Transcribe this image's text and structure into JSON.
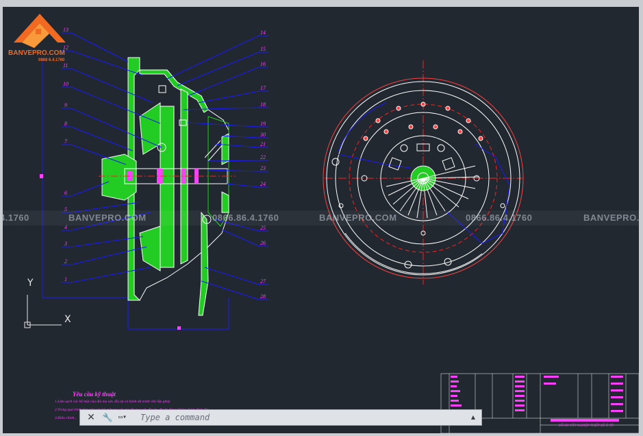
{
  "watermark": {
    "brand": "BANVEPRO.COM",
    "phone": "0866.86.4.1760",
    "phone_fragment": "4.1760",
    "brand_fragment": "BANVEPRO.C"
  },
  "logo": {
    "brand": "BANVEPRO.COM",
    "phone": "0868 6.4.1760"
  },
  "callouts_left": [
    "13",
    "12",
    "11",
    "10",
    "9",
    "8",
    "7",
    "6",
    "5",
    "4",
    "3",
    "2",
    "1"
  ],
  "callouts_right": [
    "14",
    "15",
    "16",
    "17",
    "18",
    "19",
    "30",
    "21",
    "22",
    "23",
    "24",
    "25",
    "26",
    "27",
    "28"
  ],
  "ucs": {
    "x_label": "X",
    "y_label": "Y"
  },
  "notes": {
    "title": "Yêu cầu kỹ thuật",
    "items": [
      "1.Làm sạch các bề mặt của đĩa ma sát, đĩa ép và bánh đà trước khi lắp ghép",
      "2.Trong quá trình làm việc các bề mặt ma sát của đĩa ma sát, đĩa ép, đĩa bị động không được dính dầu",
      "3.Điều chỉnh..."
    ]
  },
  "command_line": {
    "placeholder": "Type a command",
    "close_icon": "close-icon",
    "settings_icon": "wrench-icon",
    "prompt_icon": "command-prompt-icon",
    "history_icon": "chevron-up-icon"
  },
  "title_block": {
    "caption": "ĐỒ ÁN TỐT NGHIỆP  THIẾT KẾ Ô TÔ"
  },
  "colors": {
    "background": "#212830",
    "outline": "#ffffff",
    "section_fill": "#22cc22",
    "leader": "#1a1aff",
    "text": "#ff40ff",
    "center_line": "#ff2020",
    "logo": "#f26a21"
  }
}
